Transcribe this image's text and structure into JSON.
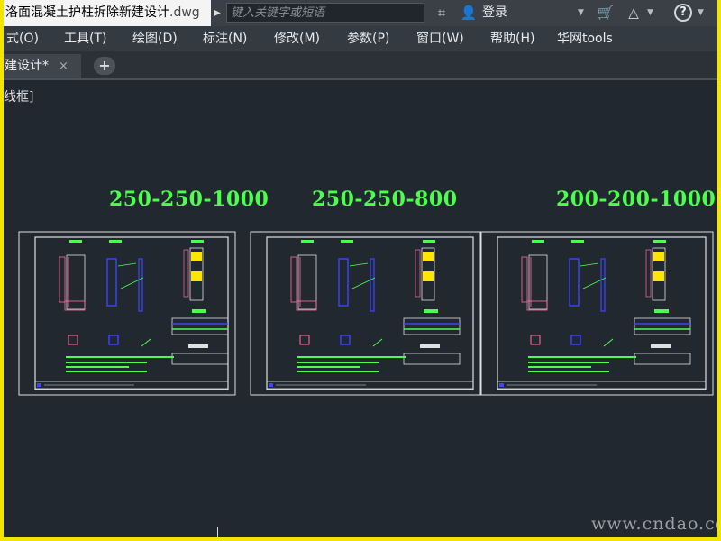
{
  "window": {
    "title_prefix": "洛面混凝土护柱拆除新建设计",
    "title_ext": ".dwg",
    "search_placeholder": "键入关键字或短语",
    "login_label": "登录",
    "help_label": "?"
  },
  "menu": {
    "items": [
      "式(O)",
      "工具(T)",
      "绘图(D)",
      "标注(N)",
      "修改(M)",
      "参数(P)",
      "窗口(W)",
      "帮助(H)",
      "华网tools"
    ]
  },
  "tabs": {
    "active_label": "建设计*",
    "close_glyph": "×",
    "add_glyph": "+"
  },
  "canvas": {
    "viewport_label": "线框]",
    "sheets": [
      {
        "title": "250-250-1000"
      },
      {
        "title": "250-250-800"
      },
      {
        "title": "200-200-1000"
      }
    ],
    "watermark": "www.cndao.com"
  },
  "colors": {
    "background": "#212830",
    "frame": "#e0e0e0",
    "title_green": "#4cff4c",
    "pink": "#ff6fa0",
    "blue": "#3c46ff",
    "yellow": "#ffe600",
    "border_yellow": "#f2e600"
  }
}
